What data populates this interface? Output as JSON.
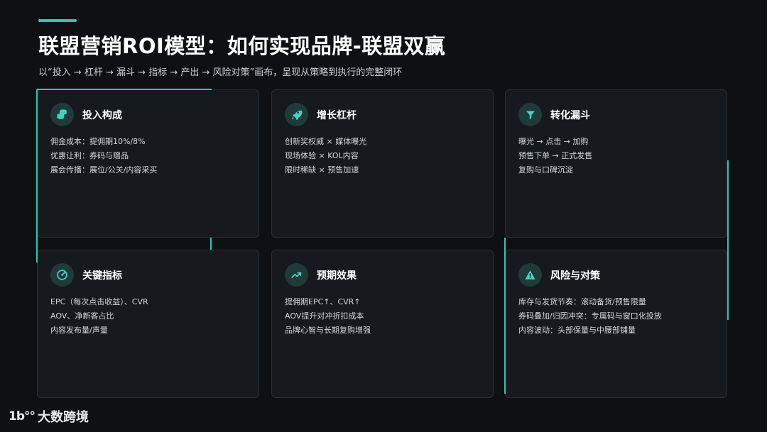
{
  "header": {
    "title": "联盟营销ROI模型：如何实现品牌-联盟双赢",
    "subtitle": "以“投入 → 杠杆 → 漏斗 → 指标 → 产出 → 风险对策”画布，呈现从策略到执行的完整闭环"
  },
  "cards": [
    {
      "title": "投入构成",
      "icon": "coins-icon",
      "lines": [
        "佣金成本：提佣期10%/8%",
        "优惠让利：券码与赠品",
        "展会传播：展位/公关/内容采买"
      ]
    },
    {
      "title": "增长杠杆",
      "icon": "rocket-icon",
      "lines": [
        "创新奖权威 × 媒体曝光",
        "现场体验 × KOL内容",
        "限时稀缺 × 预售加速"
      ]
    },
    {
      "title": "转化漏斗",
      "icon": "funnel-icon",
      "lines": [
        "曝光 → 点击 → 加购",
        "预售下单 → 正式发售",
        "复购与口碑沉淀"
      ]
    },
    {
      "title": "关键指标",
      "icon": "gauge-icon",
      "lines": [
        "EPC（每次点击收益）、CVR",
        "AOV、净新客占比",
        "内容发布量/声量"
      ]
    },
    {
      "title": "预期效果",
      "icon": "trend-up-icon",
      "lines": [
        "提佣期EPC↑、CVR↑",
        "AOV提升对冲折扣成本",
        "品牌心智与长期复购增强"
      ]
    },
    {
      "title": "风险与对策",
      "icon": "warning-icon",
      "lines": [
        "库存与发货节奏：滚动备货/预售限量",
        "券码叠加/归因冲突：专属码与窗口化投放",
        "内容波动：头部保量与中腰部铺量"
      ]
    }
  ],
  "brand": {
    "logo": "1b°°",
    "name": "大数跨境"
  },
  "colors": {
    "accent": "#2fc6b0",
    "background": "#0e1013",
    "card": "#16191e"
  }
}
